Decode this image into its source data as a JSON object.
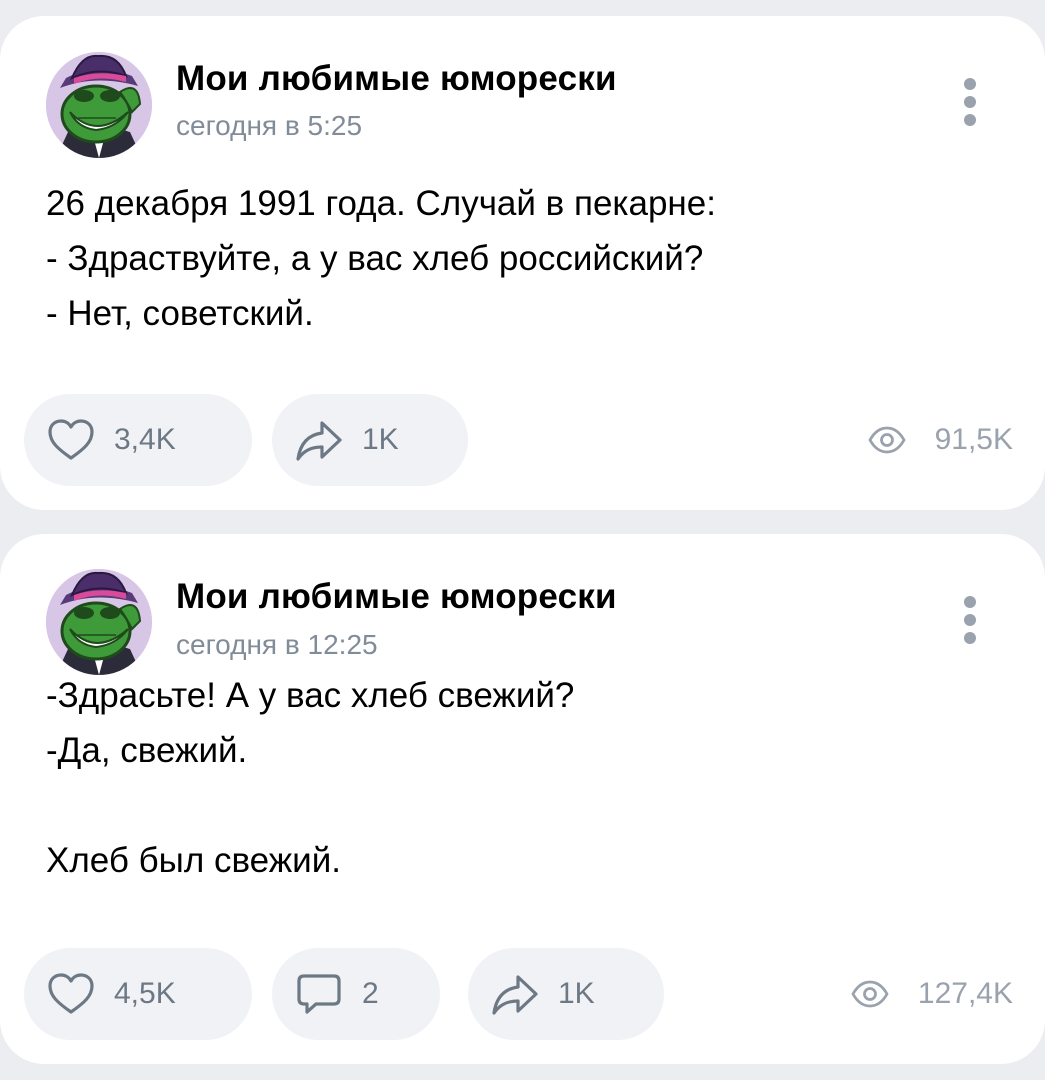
{
  "colors": {
    "background": "#ebedf0",
    "card": "#ffffff",
    "pill": "#f0f2f5",
    "secondary_text": "#818c99",
    "icon": "#99a2ad"
  },
  "posts": [
    {
      "group_name": "Мои любимые юморески",
      "time": "сегодня в 5:25",
      "text_lines": [
        "26 декабря 1991 года. Случай в пекарне:",
        "- Здраствуйте, а у вас хлеб российский?",
        "- Нет, советский."
      ],
      "likes": "3,4K",
      "shares": "1K",
      "views": "91,5K",
      "icons": {
        "more": "more-vertical-icon",
        "like": "heart-icon",
        "share": "share-arrow-icon",
        "views": "eye-icon"
      }
    },
    {
      "group_name": "Мои любимые юморески",
      "time": "сегодня в 12:25",
      "text_lines": [
        "-Здрасьте! А у вас хлеб свежий?",
        "-Да, свежий.",
        "",
        "Хлеб был свежий."
      ],
      "likes": "4,5K",
      "comments": "2",
      "shares": "1K",
      "views": "127,4K",
      "icons": {
        "more": "more-vertical-icon",
        "like": "heart-icon",
        "comment": "comment-bubble-icon",
        "share": "share-arrow-icon",
        "views": "eye-icon"
      }
    }
  ]
}
